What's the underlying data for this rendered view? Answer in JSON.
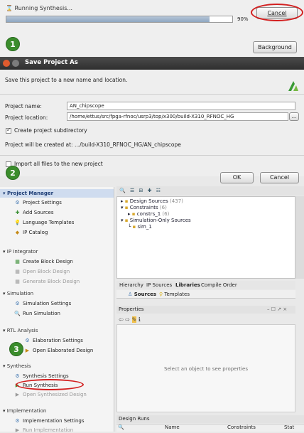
{
  "synthesis_dialog": {
    "title": "Running Synthesis...",
    "progress_percent": 90,
    "progress_text": "90%",
    "cancel_label": "Cancel",
    "background_label": "Background"
  },
  "steps": {
    "one": "1",
    "two": "2",
    "three": "3"
  },
  "save_dialog": {
    "title": "Save Project As",
    "description": "Save this project to a new name and location.",
    "project_name_label": "Project name:",
    "project_name_value": "AN_chipscope",
    "project_location_label": "Project location:",
    "project_location_value": "/home/ettus/src/fpga-rfnoc/usrp3/top/x300/build-X310_RFNOC_HG",
    "create_subdir_label": "Create project subdirectory",
    "created_at_label": "Project will be created at:   .../build-X310_RFNOC_HG/AN_chipscope",
    "import_files_label": "Import all files to the new project",
    "ok_label": "OK",
    "cancel_label": "Cancel"
  },
  "flow_navigator": {
    "project_manager": "Project Manager",
    "project_settings": "Project Settings",
    "add_sources": "Add Sources",
    "language_templates": "Language Templates",
    "ip_catalog": "IP Catalog",
    "ip_integrator": "IP Integrator",
    "create_block_design": "Create Block Design",
    "open_block_design": "Open Block Design",
    "generate_block_design": "Generate Block Design",
    "simulation": "Simulation",
    "simulation_settings": "Simulation Settings",
    "run_simulation": "Run Simulation",
    "rtl_analysis": "RTL Analysis",
    "elaboration_settings": "Elaboration Settings",
    "open_elaborated_design": "Open Elaborated Design",
    "synthesis": "Synthesis",
    "synthesis_settings": "Synthesis Settings",
    "run_synthesis": "Run Synthesis",
    "open_synthesized_design": "Open Synthesized Design",
    "implementation": "Implementation",
    "implementation_settings": "Implementation Settings",
    "run_implementation": "Run Implementation"
  },
  "sources": {
    "design_sources": "Design Sources",
    "design_sources_count": "(437)",
    "constraints": "Constraints",
    "constraints_count": "(6)",
    "constrs_1": "constrs_1",
    "constrs_1_count": "(6)",
    "simulation_only": "Simulation-Only Sources",
    "sim_1": "sim_1",
    "tabs_row1": [
      "Hierarchy",
      "IP Sources",
      "Libraries",
      "Compile Order"
    ],
    "tabs_row2": [
      "Sources",
      "Templates"
    ]
  },
  "properties": {
    "title": "Properties",
    "controls": "– ☐ ↗ ×",
    "empty_text": "Select an object to see properties"
  },
  "design_runs": {
    "title": "Design Runs",
    "columns": [
      "Name",
      "Constraints",
      "Stat"
    ]
  },
  "colors": {
    "accent_red": "#d32020",
    "step_green": "#3b8d2c",
    "titlebar": "#3a3a3a"
  }
}
